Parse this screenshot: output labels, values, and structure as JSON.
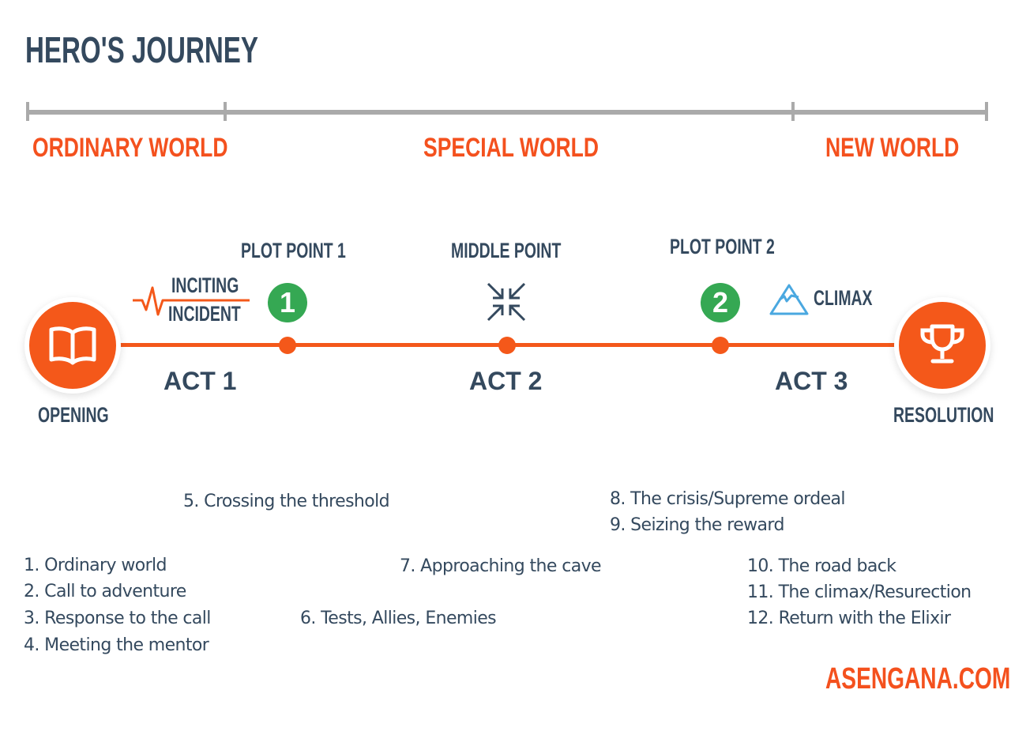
{
  "title": "HERO'S JOURNEY",
  "worlds": [
    {
      "label": "ORDINARY WORLD"
    },
    {
      "label": "SPECIAL WORLD"
    },
    {
      "label": "NEW WORLD"
    }
  ],
  "timeline": {
    "start": {
      "label": "OPENING",
      "icon": "book-icon"
    },
    "end": {
      "label": "RESOLUTION",
      "icon": "trophy-icon"
    },
    "inciting_incident": {
      "line1": "INCITING",
      "line2": "INCIDENT",
      "icon": "heartbeat-icon"
    },
    "plot_point_1": {
      "label": "PLOT POINT 1",
      "badge": "1"
    },
    "middle_point": {
      "label": "MIDDLE POINT",
      "icon": "compress-arrows-icon"
    },
    "plot_point_2": {
      "label": "PLOT POINT 2",
      "badge": "2"
    },
    "climax": {
      "label": "CLIMAX",
      "icon": "mountain-icon"
    },
    "acts": [
      "ACT 1",
      "ACT 2",
      "ACT 3"
    ]
  },
  "steps": [
    "1. Ordinary world",
    "2. Call to adventure",
    "3. Response to the call",
    "4. Meeting the mentor",
    "5. Crossing the threshold",
    "6. Tests, Allies, Enemies",
    "7. Approaching the cave",
    "8. The crisis/Supreme ordeal",
    "9. Seizing the reward",
    "10. The road back",
    "11. The climax/Resurection",
    "12. Return with the Elixir"
  ],
  "brand": "ASENGANA.COM",
  "colors": {
    "accent": "#f4581a",
    "dark": "#34495e",
    "green": "#35a853",
    "blue": "#4aa8e0",
    "rule": "#aaaaaa"
  }
}
